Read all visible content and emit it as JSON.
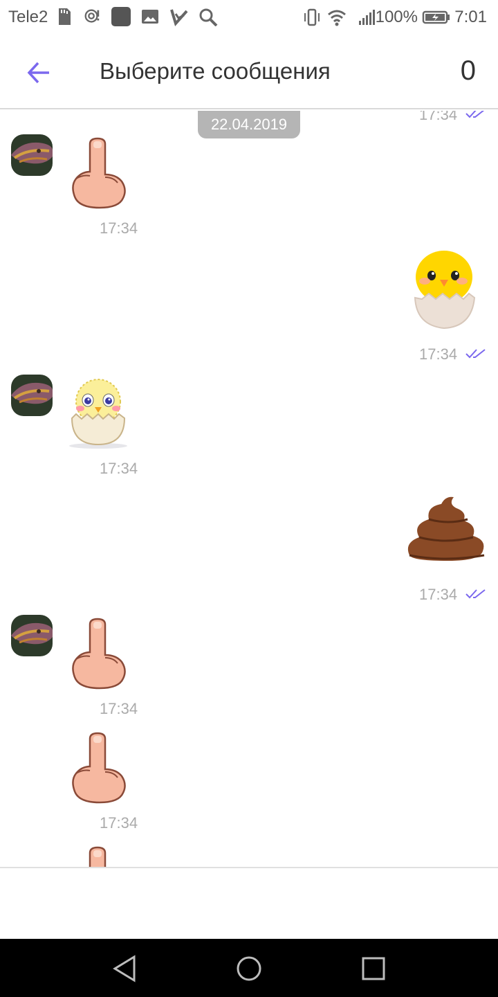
{
  "status_bar": {
    "carrier": "Tele2",
    "battery": "100%",
    "time": "7:01",
    "icons": [
      "sd-card-icon",
      "hotspot-icon",
      "app-square-icon",
      "image-icon",
      "vk-icon",
      "search-icon",
      "vibrate-icon",
      "wifi-icon",
      "signal-icon",
      "battery-icon"
    ]
  },
  "header": {
    "title": "Выберите сообщения",
    "selected_count": "0",
    "back_icon": "arrow-left-icon"
  },
  "chat": {
    "date_label": "22.04.2019",
    "top_partial_time": "17:34",
    "messages": [
      {
        "side": "incoming",
        "sticker": "middle-finger-sticker",
        "time": "17:34"
      },
      {
        "side": "outgoing",
        "sticker": "chick-in-egg-sticker",
        "time": "17:34"
      },
      {
        "side": "incoming",
        "sticker": "fluffy-chick-sticker",
        "time": "17:34"
      },
      {
        "side": "outgoing",
        "sticker": "poop-sticker",
        "time": "17:34"
      },
      {
        "side": "incoming",
        "sticker": "middle-finger-sticker",
        "time": "17:34"
      },
      {
        "side": "incoming",
        "sticker": "middle-finger-sticker",
        "time": "17:34"
      }
    ]
  },
  "colors": {
    "accent": "#7b68ee",
    "date_pill": "#b5b5b5",
    "time_text": "#aaaaaa"
  },
  "nav_bar": {
    "back": "triangle-back-icon",
    "home": "circle-home-icon",
    "recents": "square-recents-icon"
  }
}
